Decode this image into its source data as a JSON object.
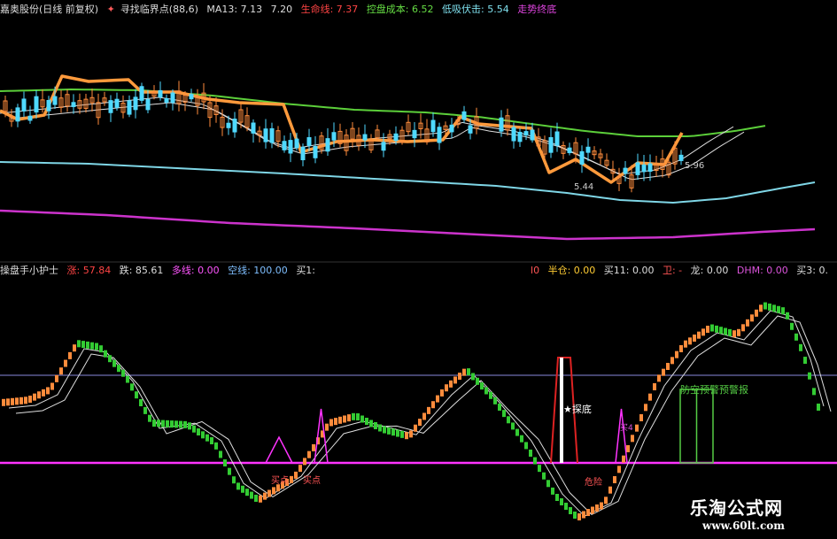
{
  "top_header": {
    "stock_name": "嘉奥股份(日线 前复权)",
    "indicator_name": "寻找临界点(88,6)",
    "ma13_label": "MA13: 7.13",
    "ma13_value2": "7.20",
    "life_line": "生命线: 7.37",
    "control_cost": "控盘成本: 6.52",
    "low_absorb": "低吸伏击: 5.54",
    "trend_end": "走势终底"
  },
  "bottom_header": {
    "title": "操盘手小护士",
    "rise": "涨: 57.84",
    "fall": "跌: 85.61",
    "long_line": "多线: 0.00",
    "short_line": "空线: 100.00",
    "buy1": "买1:"
  },
  "bottom_header_right": {
    "item0": "l0",
    "half_pos": "半仓: 0.00",
    "buy11": "买11: 0.00",
    "exit": "卫: -",
    "dragon": "龙: 0.00",
    "dhm": "DHM: 0.00",
    "buy3": "买3: 0."
  },
  "annotations": {
    "price_low_label": "5.44",
    "price_right_label": "5.96",
    "explore_bottom": "★探底",
    "buy_point_a": "买点",
    "buy_point_b": "买点",
    "danger_label": "危险",
    "alert_label": "防空预警预警报",
    "buy_small": "买4"
  },
  "watermark": {
    "title": "乐淘公式网",
    "url": "www.60lt.com"
  },
  "colors": {
    "up_candle": "#ff8c3c",
    "down_candle": "#4fd9ff",
    "ma_green": "#5ccf3a",
    "ma_orange": "#ff9a3c",
    "ma_white": "#dddddd",
    "ma_cyan": "#7fd6e6",
    "ma_magenta": "#cc33cc",
    "osc_up": "#ff8c3c",
    "osc_down": "#33cc33",
    "line_magenta": "#ff33ff",
    "line_blue": "#8888dd"
  },
  "chart_data": [
    {
      "type": "candlestick",
      "panel": "price",
      "title": "寻找临界点(88,6)",
      "series": [
        {
          "name": "MA13",
          "values": [
            7.13
          ]
        },
        {
          "name": "生命线",
          "values": [
            7.37
          ]
        },
        {
          "name": "控盘成本",
          "values": [
            6.52
          ]
        },
        {
          "name": "低吸伏击",
          "values": [
            5.54
          ]
        }
      ],
      "annotations": [
        "5.44",
        "5.96"
      ]
    },
    {
      "type": "line",
      "panel": "oscillator",
      "title": "操盘手小护士",
      "series": [
        {
          "name": "涨",
          "values": [
            57.84
          ]
        },
        {
          "name": "跌",
          "values": [
            85.61
          ]
        },
        {
          "name": "多线",
          "values": [
            0.0
          ]
        },
        {
          "name": "空线",
          "values": [
            100.0
          ]
        }
      ]
    }
  ]
}
